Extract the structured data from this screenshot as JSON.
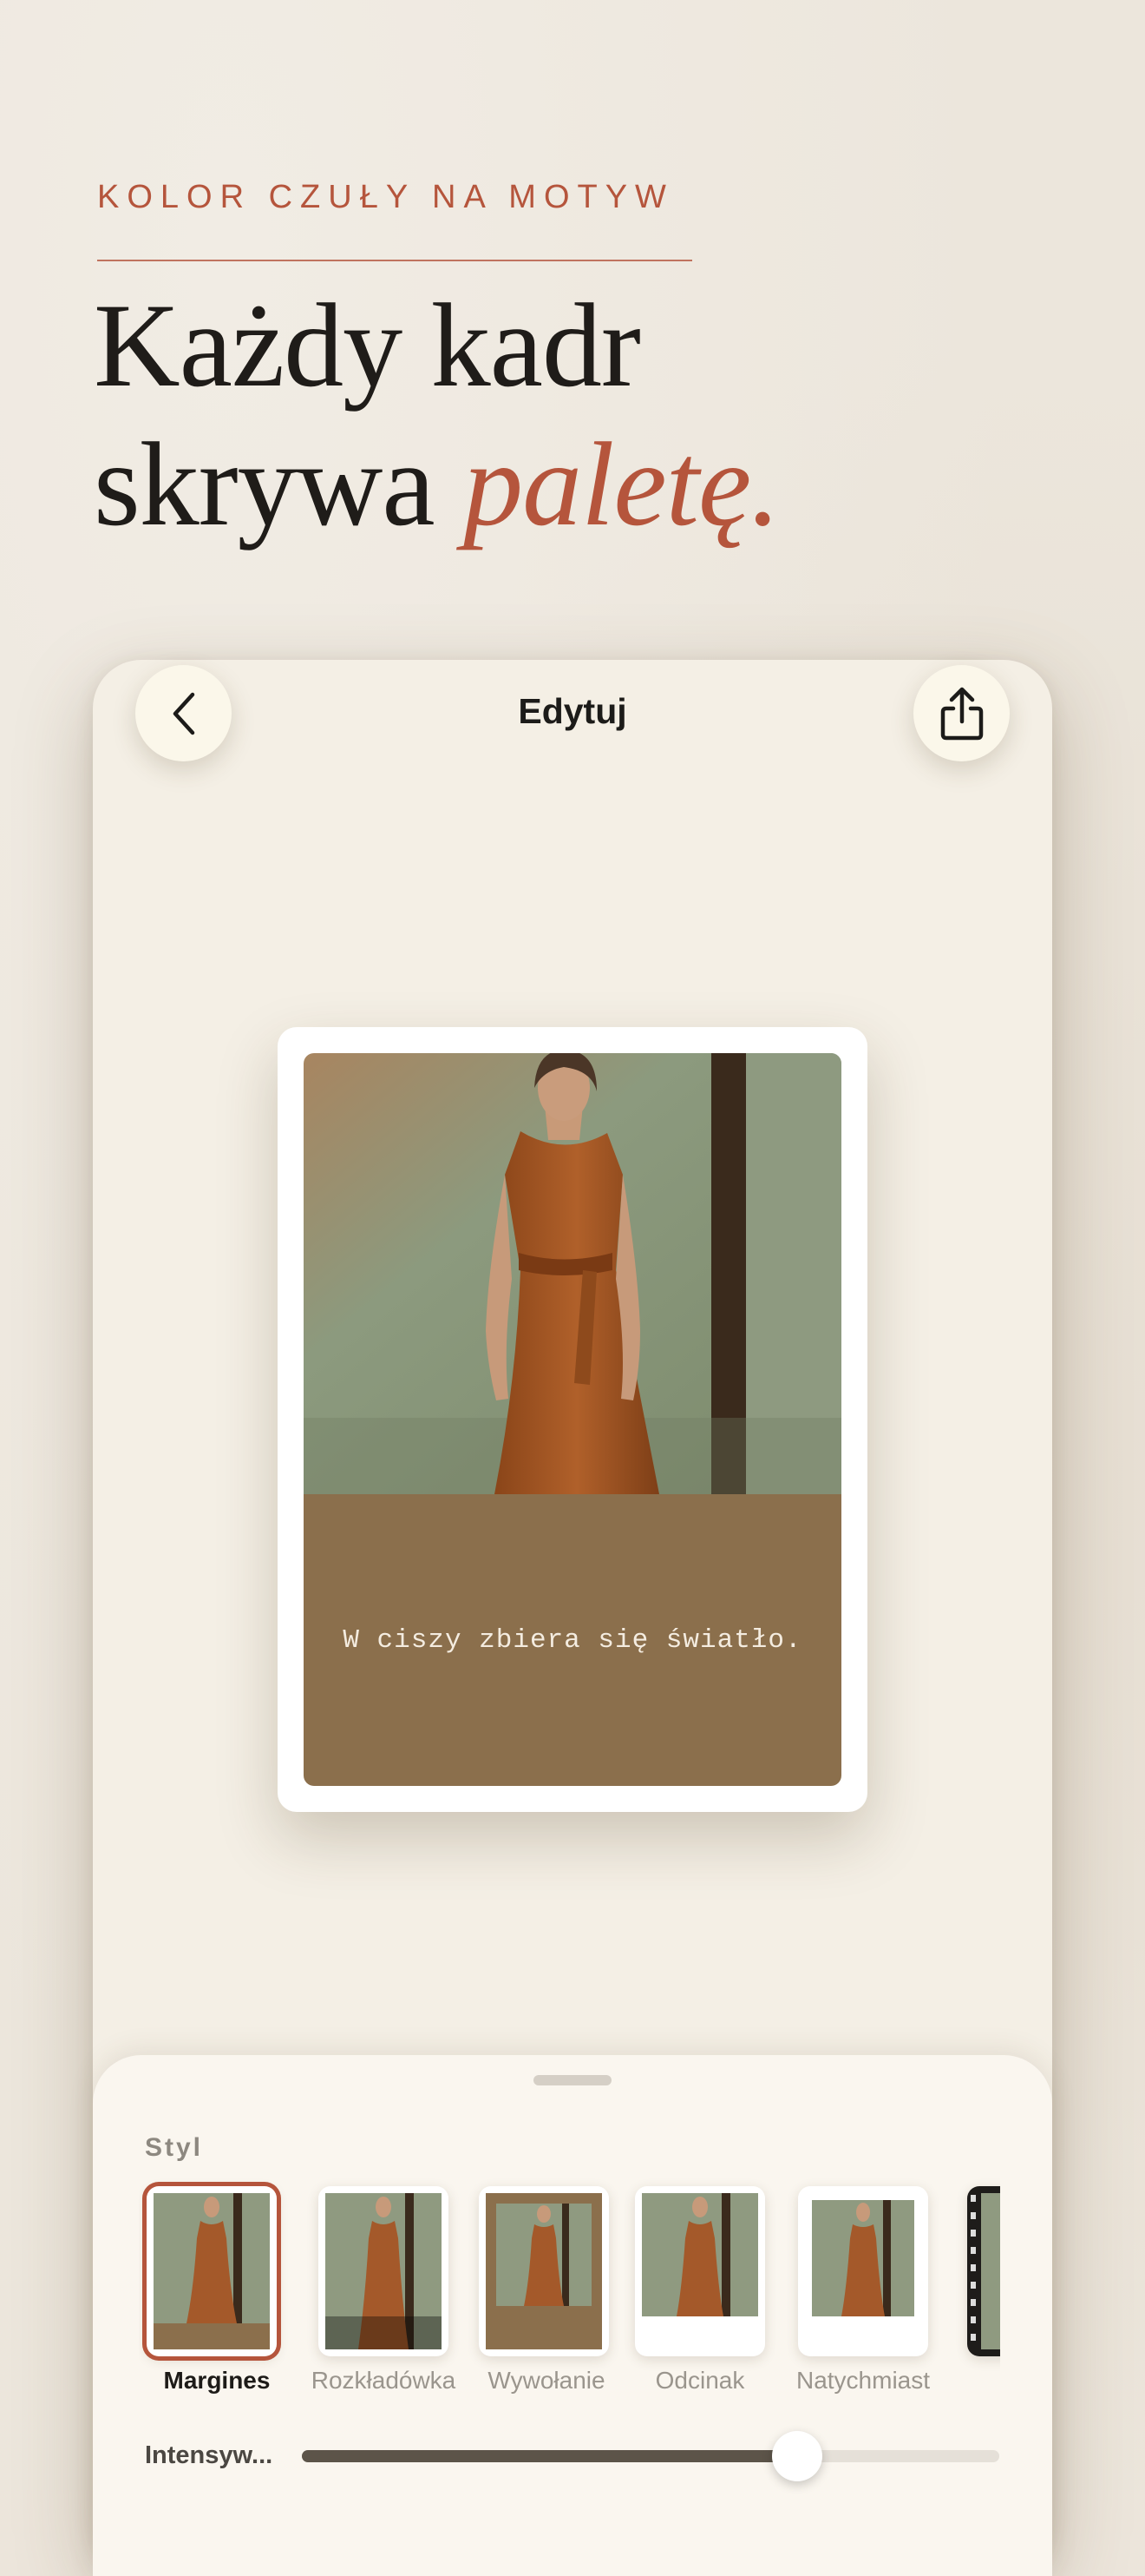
{
  "hero": {
    "eyebrow": "KOLOR CZUŁY NA MOTYW",
    "headline_line1": "Każdy kadr",
    "headline_line2_plain": "skrywa ",
    "headline_line2_accent": "paletę."
  },
  "colors": {
    "accent": "#b5553c",
    "card_bottom": "#8b6f4c",
    "text_dark": "#1f1c19"
  },
  "nav": {
    "title": "Edytuj",
    "back_icon": "chevron-left-icon",
    "share_icon": "share-icon"
  },
  "preview": {
    "caption": "W ciszy zbiera się światło."
  },
  "sheet": {
    "section_label": "Styl",
    "styles": [
      {
        "label": "Margines",
        "selected": true
      },
      {
        "label": "Rozkładówka",
        "selected": false
      },
      {
        "label": "Wywołanie",
        "selected": false
      },
      {
        "label": "Odcinak",
        "selected": false
      },
      {
        "label": "Natychmiast",
        "selected": false
      }
    ],
    "intensity": {
      "label": "Intensyw...",
      "value": 0.71
    }
  }
}
